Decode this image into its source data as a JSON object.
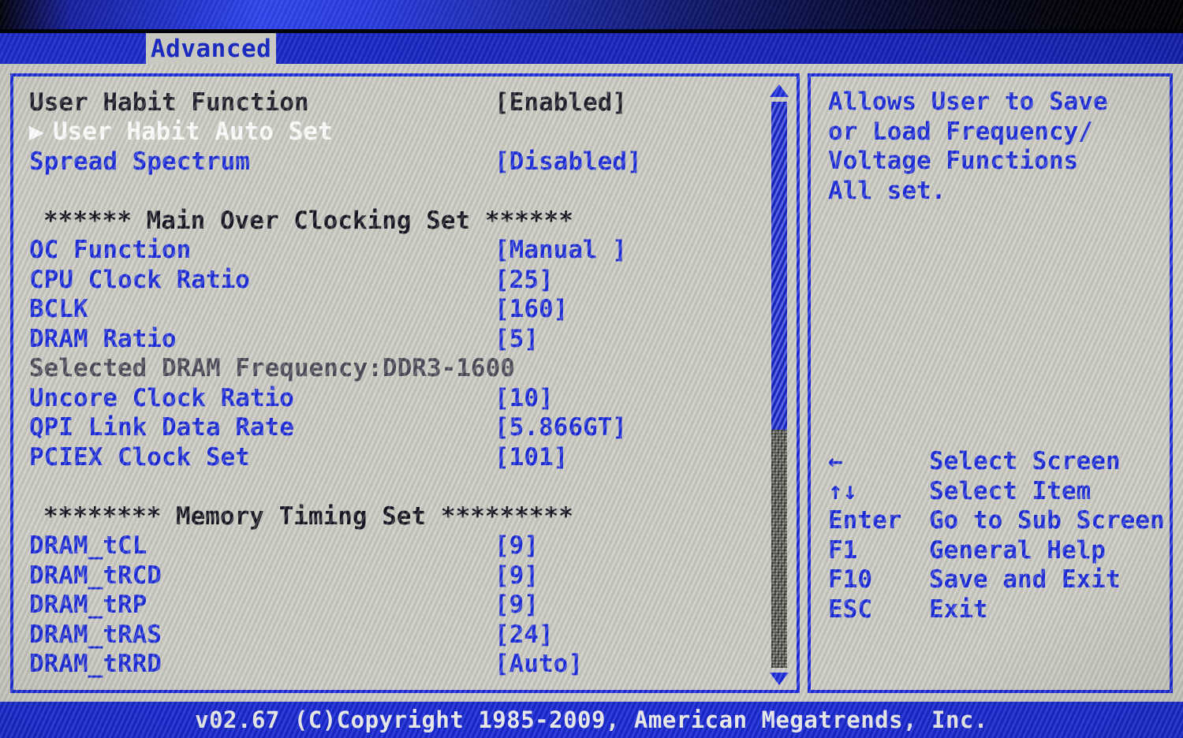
{
  "tab": {
    "label": "Advanced"
  },
  "menu": {
    "rows": [
      {
        "type": "item",
        "label": "User Habit Function",
        "value": "[Enabled]",
        "color": "dark",
        "marker": ""
      },
      {
        "type": "submenu",
        "label": "User Habit Auto Set",
        "value": "",
        "color": "white",
        "marker": "▶"
      },
      {
        "type": "item",
        "label": "Spread Spectrum",
        "value": "[Disabled]",
        "color": "blue",
        "marker": ""
      },
      {
        "type": "spacer",
        "label": "",
        "value": "",
        "color": "dark",
        "marker": ""
      },
      {
        "type": "heading",
        "label": "****** Main Over Clocking Set ******",
        "value": "",
        "color": "dark",
        "marker": ""
      },
      {
        "type": "item",
        "label": "OC Function",
        "value": "[Manual ]",
        "color": "blue",
        "marker": ""
      },
      {
        "type": "item",
        "label": "CPU Clock Ratio",
        "value": "[25]",
        "color": "blue",
        "marker": ""
      },
      {
        "type": "item",
        "label": "BCLK",
        "value": "[160]",
        "color": "blue",
        "marker": ""
      },
      {
        "type": "item",
        "label": "DRAM Ratio",
        "value": "[5]",
        "color": "blue",
        "marker": ""
      },
      {
        "type": "info",
        "label": "Selected DRAM Frequency:DDR3-1600",
        "value": "",
        "color": "gray",
        "marker": ""
      },
      {
        "type": "item",
        "label": "Uncore Clock Ratio",
        "value": "[10]",
        "color": "blue",
        "marker": ""
      },
      {
        "type": "item",
        "label": "QPI Link Data Rate",
        "value": "[5.866GT]",
        "color": "blue",
        "marker": ""
      },
      {
        "type": "item",
        "label": "PCIEX Clock Set",
        "value": "[101]",
        "color": "blue",
        "marker": ""
      },
      {
        "type": "spacer",
        "label": "",
        "value": "",
        "color": "dark",
        "marker": ""
      },
      {
        "type": "heading",
        "label": "******** Memory Timing Set *********",
        "value": "",
        "color": "dark",
        "marker": ""
      },
      {
        "type": "item",
        "label": "DRAM_tCL",
        "value": "[9]",
        "color": "blue",
        "marker": ""
      },
      {
        "type": "item",
        "label": "DRAM_tRCD",
        "value": "[9]",
        "color": "blue",
        "marker": ""
      },
      {
        "type": "item",
        "label": "DRAM_tRP",
        "value": "[9]",
        "color": "blue",
        "marker": ""
      },
      {
        "type": "item",
        "label": "DRAM_tRAS",
        "value": "[24]",
        "color": "blue",
        "marker": ""
      },
      {
        "type": "item",
        "label": "DRAM_tRRD",
        "value": "[Auto]",
        "color": "blue",
        "marker": ""
      }
    ]
  },
  "scrollbar": {
    "up_arrow": "scroll-up-arrow",
    "down_arrow": "scroll-down-arrow",
    "thumb_fraction_percent": 58
  },
  "help": {
    "lines": [
      "Allows User to Save",
      "or Load Frequency/",
      "Voltage Functions",
      "All set."
    ]
  },
  "legend": {
    "rows": [
      {
        "key": "←",
        "desc": "Select Screen"
      },
      {
        "key": "↑↓",
        "desc": "Select Item"
      },
      {
        "key": "Enter",
        "desc": "Go to Sub Screen"
      },
      {
        "key": "F1",
        "desc": "General Help"
      },
      {
        "key": "F10",
        "desc": "Save and Exit"
      },
      {
        "key": "ESC",
        "desc": "Exit"
      }
    ]
  },
  "footer": {
    "copyright": "v02.67 (C)Copyright 1985-2009, American Megatrends, Inc."
  },
  "colors": {
    "accent_blue": "#1b2bd8",
    "panel_bg": "#c9c9c1",
    "text_dark": "#1c1c28",
    "text_white": "#fdfdfd",
    "text_gray": "#4a4a58"
  }
}
